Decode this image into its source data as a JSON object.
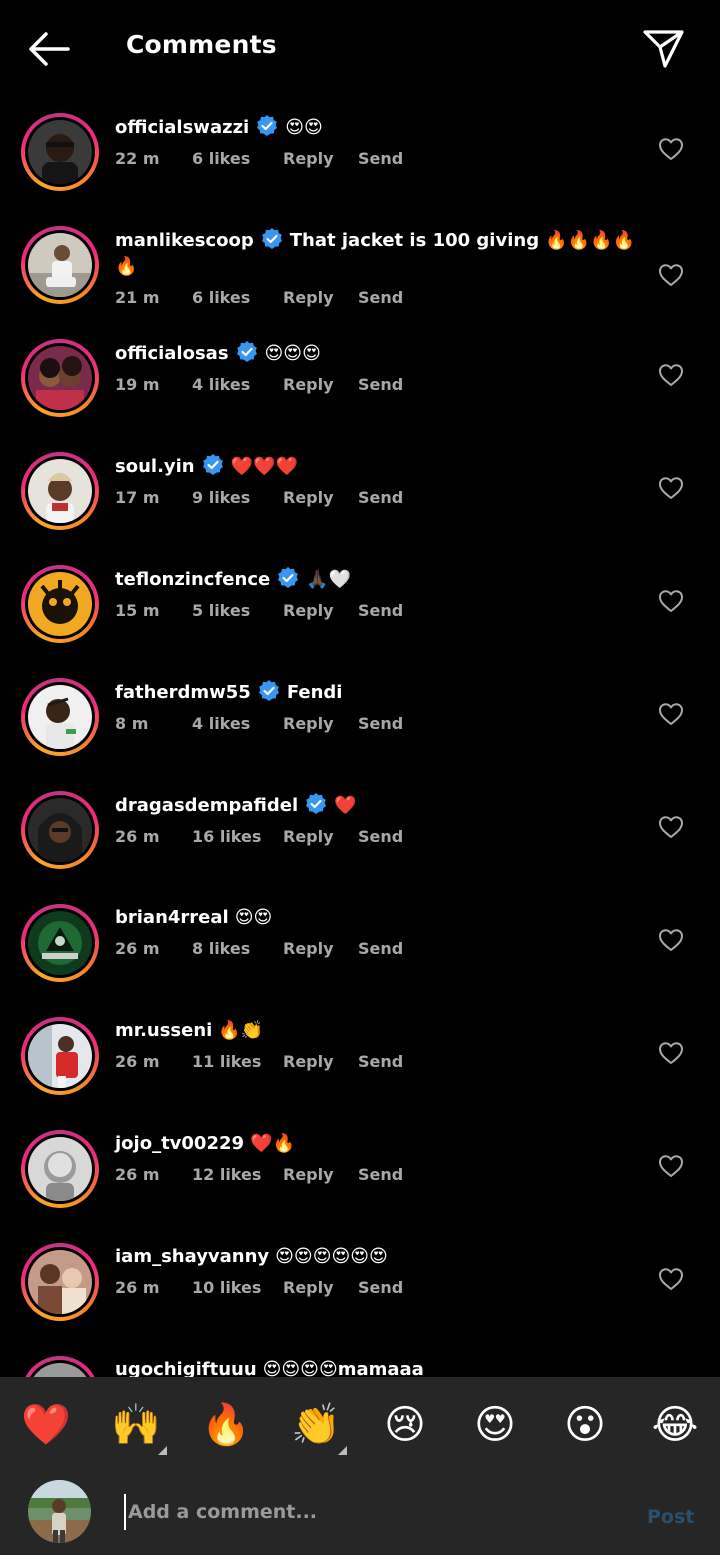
{
  "header": {
    "title": "Comments",
    "back_icon": "arrow-left-icon",
    "share_icon": "paper-plane-icon"
  },
  "comments": [
    {
      "username": "officialswazzi",
      "verified": true,
      "text": "😍😍",
      "time": "22 m",
      "likes": "6 likes",
      "reply": "Reply",
      "send": "Send"
    },
    {
      "username": "manlikescoop",
      "verified": true,
      "text": "That jacket is 100 giving 🔥🔥🔥🔥🔥",
      "time": "21 m",
      "likes": "6 likes",
      "reply": "Reply",
      "send": "Send"
    },
    {
      "username": "officialosas",
      "verified": true,
      "text": "😍😍😍",
      "time": "19 m",
      "likes": "4 likes",
      "reply": "Reply",
      "send": "Send"
    },
    {
      "username": "soul.yin",
      "verified": true,
      "text": "❤️❤️❤️",
      "time": "17 m",
      "likes": "9 likes",
      "reply": "Reply",
      "send": "Send"
    },
    {
      "username": "teflonzincfence",
      "verified": true,
      "text": "🙏🏿🤍",
      "time": "15 m",
      "likes": "5 likes",
      "reply": "Reply",
      "send": "Send"
    },
    {
      "username": "fatherdmw55",
      "verified": true,
      "text": "Fendi",
      "time": "8 m",
      "likes": "4 likes",
      "reply": "Reply",
      "send": "Send"
    },
    {
      "username": "dragasdempafidel",
      "verified": true,
      "text": "❤️",
      "time": "26 m",
      "likes": "16 likes",
      "reply": "Reply",
      "send": "Send"
    },
    {
      "username": "brian4rreal",
      "verified": false,
      "text": "😍😍",
      "time": "26 m",
      "likes": "8 likes",
      "reply": "Reply",
      "send": "Send"
    },
    {
      "username": "mr.usseni",
      "verified": false,
      "text": "🔥👏",
      "time": "26 m",
      "likes": "11 likes",
      "reply": "Reply",
      "send": "Send"
    },
    {
      "username": "jojo_tv00229",
      "verified": false,
      "text": "❤️🔥",
      "time": "26 m",
      "likes": "12 likes",
      "reply": "Reply",
      "send": "Send"
    },
    {
      "username": "iam_shayvanny",
      "verified": false,
      "text": "😍😍😍😍😍😍",
      "time": "26 m",
      "likes": "10 likes",
      "reply": "Reply",
      "send": "Send"
    },
    {
      "username": "ugochigiftuuu",
      "verified": false,
      "text": "😍😍😍😍mamaaa",
      "time": "",
      "likes": "",
      "reply": "",
      "send": ""
    }
  ],
  "emoji_bar": {
    "items": [
      {
        "emoji": "❤️",
        "name": "red-heart",
        "has_variants": false
      },
      {
        "emoji": "🙌",
        "name": "raising-hands",
        "has_variants": true
      },
      {
        "emoji": "🔥",
        "name": "fire",
        "has_variants": false
      },
      {
        "emoji": "👏",
        "name": "clapping-hands",
        "has_variants": true
      },
      {
        "emoji": "😢",
        "name": "crying-face",
        "has_variants": false
      },
      {
        "emoji": "😍",
        "name": "heart-eyes",
        "has_variants": false
      },
      {
        "emoji": "😮",
        "name": "surprised-face",
        "has_variants": false
      },
      {
        "emoji": "😂",
        "name": "tears-of-joy",
        "has_variants": false
      }
    ]
  },
  "composer": {
    "placeholder": "Add a comment...",
    "post_label": "Post"
  },
  "colors": {
    "background": "#000000",
    "panel": "#262626",
    "meta_text": "#a8a8a8",
    "verified": "#3897f0",
    "post_disabled": "#2b4f6e"
  }
}
